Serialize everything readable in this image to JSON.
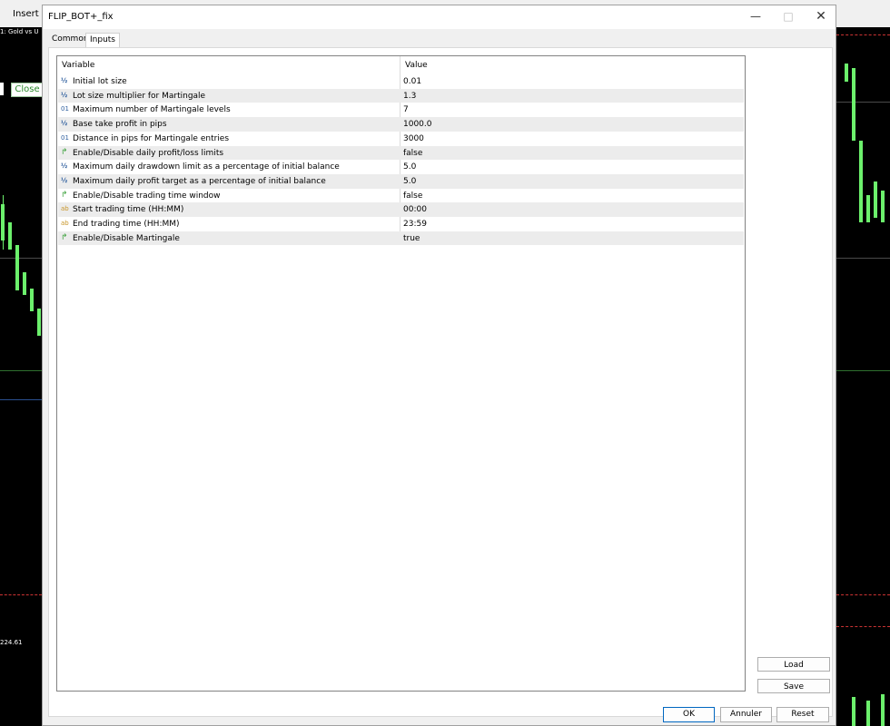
{
  "background": {
    "menu_label": "Insert",
    "symbol_label": "1: Gold vs U",
    "close_button": "Close",
    "price_label": "224.61"
  },
  "dialog": {
    "title": "FLIP_BOT+_fix",
    "tabs": [
      "Common",
      "Inputs"
    ],
    "active_tab": "Inputs",
    "columns": {
      "variable": "Variable",
      "value": "Value"
    },
    "rows": [
      {
        "type": "double",
        "icon": "half-icon",
        "variable": "Initial lot size",
        "value": "0.01"
      },
      {
        "type": "double",
        "icon": "half-icon",
        "variable": "Lot size multiplier for Martingale",
        "value": "1.3"
      },
      {
        "type": "int",
        "icon": "int-icon",
        "variable": "Maximum number of Martingale levels",
        "value": "7"
      },
      {
        "type": "double",
        "icon": "half-icon",
        "variable": "Base take profit in pips",
        "value": "1000.0"
      },
      {
        "type": "int",
        "icon": "int-icon",
        "variable": "Distance in pips for Martingale entries",
        "value": "3000"
      },
      {
        "type": "bool",
        "icon": "bool-icon",
        "variable": "Enable/Disable daily profit/loss limits",
        "value": "false"
      },
      {
        "type": "double",
        "icon": "half-icon",
        "variable": "Maximum daily drawdown limit as a percentage of initial balance",
        "value": "5.0"
      },
      {
        "type": "double",
        "icon": "half-icon",
        "variable": "Maximum daily profit target as a percentage of initial balance",
        "value": "5.0"
      },
      {
        "type": "bool",
        "icon": "bool-icon",
        "variable": "Enable/Disable trading time window",
        "value": "false"
      },
      {
        "type": "string",
        "icon": "string-icon",
        "variable": "Start trading time (HH:MM)",
        "value": "00:00"
      },
      {
        "type": "string",
        "icon": "string-icon",
        "variable": "End trading time (HH:MM)",
        "value": "23:59"
      },
      {
        "type": "bool",
        "icon": "bool-icon",
        "variable": "Enable/Disable Martingale",
        "value": "true"
      }
    ],
    "buttons": {
      "load": "Load",
      "save": "Save",
      "ok": "OK",
      "cancel": "Annuler",
      "reset": "Reset"
    }
  }
}
